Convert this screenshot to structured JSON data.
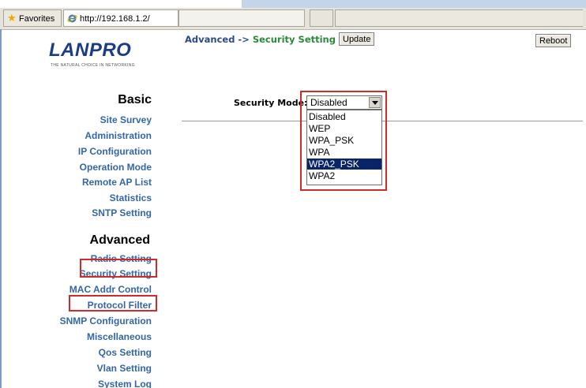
{
  "browser": {
    "favorites_label": "Favorites",
    "url": "http://192.168.1.2/"
  },
  "logo": {
    "text": "LANPRO",
    "tagline": "THE NATURAL CHOICE IN NETWORKING"
  },
  "sidebar": {
    "basic_heading": "Basic",
    "basic_items": [
      {
        "label": "Site Survey"
      },
      {
        "label": "Administration"
      },
      {
        "label": "IP Configuration"
      },
      {
        "label": "Operation Mode"
      },
      {
        "label": "Remote AP List"
      },
      {
        "label": "Statistics"
      },
      {
        "label": "SNTP Setting"
      }
    ],
    "advanced_heading": "Advanced",
    "advanced_items": [
      {
        "label": "Radio Setting"
      },
      {
        "label": "Security Setting"
      },
      {
        "label": "MAC Addr Control"
      },
      {
        "label": "Protocol Filter"
      },
      {
        "label": "SNMP Configuration"
      },
      {
        "label": "Miscellaneous"
      },
      {
        "label": "Qos Setting"
      },
      {
        "label": "Vlan Setting"
      },
      {
        "label": "System Log"
      }
    ]
  },
  "main": {
    "breadcrumb_part1": "Advanced -> ",
    "breadcrumb_part2": "Security Setting",
    "update_label": "Update",
    "reboot_label": "Reboot",
    "security_mode_label": "Security Mode:",
    "security_mode_value": "Disabled",
    "security_mode_options": [
      {
        "label": "Disabled",
        "highlighted": false
      },
      {
        "label": "WEP",
        "highlighted": false
      },
      {
        "label": "WPA_PSK",
        "highlighted": false
      },
      {
        "label": "WPA",
        "highlighted": false
      },
      {
        "label": "WPA2_PSK",
        "highlighted": true
      },
      {
        "label": "WPA2",
        "highlighted": false
      }
    ]
  },
  "colors": {
    "highlight_box": "#d12a2a",
    "nav_link": "#3366aa",
    "breadcrumb": "#2a4a8a",
    "breadcrumb_accent": "#2a8a3a",
    "selected_option": "#0a246a"
  }
}
